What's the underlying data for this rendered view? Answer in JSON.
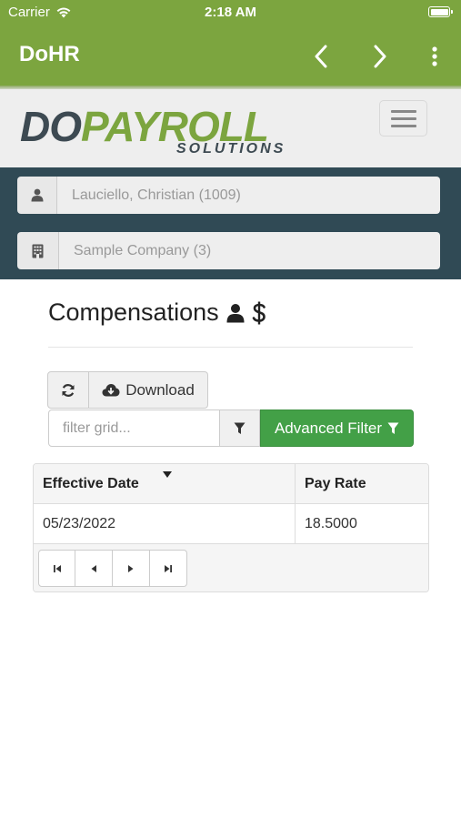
{
  "status": {
    "carrier": "Carrier",
    "time": "2:18 AM"
  },
  "appbar": {
    "title": "DoHR"
  },
  "logo": {
    "do": "DO",
    "payroll": "PAYROLL",
    "sub": "SOLUTIONS"
  },
  "selectors": {
    "employee": {
      "value": "Lauciello, Christian (1009)"
    },
    "company": {
      "value": "Sample Company (3)"
    }
  },
  "page": {
    "title": "Compensations"
  },
  "toolbar": {
    "download_label": "Download"
  },
  "filter": {
    "placeholder": "filter grid...",
    "advanced_label": "Advanced Filter"
  },
  "grid": {
    "columns": [
      "Effective Date",
      "Pay Rate"
    ],
    "rows": [
      [
        "05/23/2022",
        "18.5000"
      ]
    ]
  },
  "colors": {
    "brand_green": "#7ca53f",
    "dark_band": "#304a55",
    "button_green": "#43a047"
  }
}
